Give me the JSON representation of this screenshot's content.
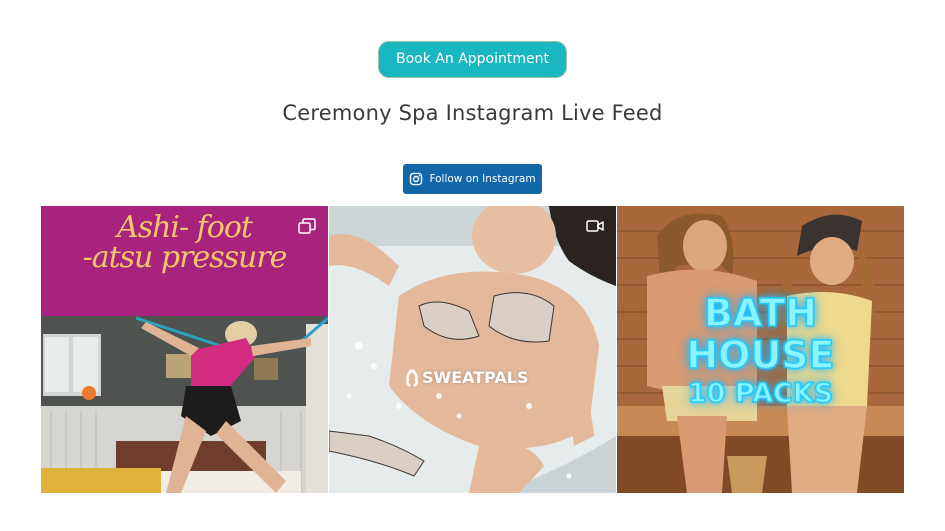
{
  "booking": {
    "label": "Book An Appointment"
  },
  "feed": {
    "title": "Ceremony Spa Instagram Live Feed",
    "follow_label": "Follow on Instagram"
  },
  "posts": [
    {
      "type": "carousel",
      "badge_icon": "carousel-icon",
      "overlay_line1": "Ashi- foot",
      "overlay_line2": "-atsu pressure",
      "brand_color": "#a8237e"
    },
    {
      "type": "video",
      "badge_icon": "video-icon",
      "logo_text": "SWEATPALS"
    },
    {
      "type": "image",
      "overlay_line1": "BATH",
      "overlay_line2": "HOUSE",
      "overlay_line3": "10 PACKS"
    }
  ],
  "colors": {
    "book_button": "#1ab7c0",
    "follow_button": "#1167a8",
    "title_text": "#3a3a3a",
    "neon": "#25c9ff"
  }
}
